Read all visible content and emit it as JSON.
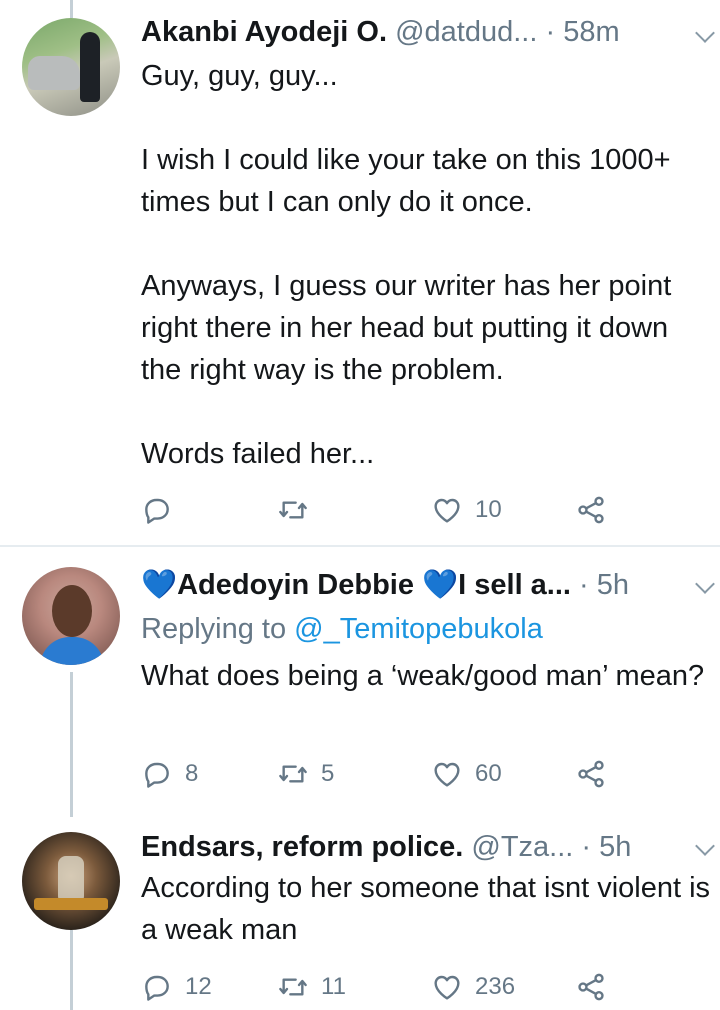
{
  "tweets": [
    {
      "name": "Akanbi Ayodeji O.",
      "handle": "@datdud...",
      "separator": "·",
      "time": "58m",
      "text": "Guy, guy, guy...\n\nI wish I could like your take on this 1000+ times but I can only do it once.\n\nAnyways, I guess our writer has her point right there in her head but putting it down the right way is the problem.\n\nWords failed her...",
      "reply_count": "",
      "retweet_count": "",
      "like_count": "10"
    },
    {
      "name_prefix_emoji": "💙",
      "name": "Adedoyin Debbie",
      "name_mid_emoji": "💙",
      "name_suffix": "I sell a...",
      "separator": "·",
      "time": "5h",
      "replying_label": "Replying to",
      "replying_mention": "@_Temitopebukola",
      "text": "What does being a ‘weak/good man’ mean?",
      "reply_count": "8",
      "retweet_count": "5",
      "like_count": "60"
    },
    {
      "name": "Endsars, reform police.",
      "handle": "@Tza...",
      "separator": "·",
      "time": "5h",
      "text": "According to her someone that isnt violent is a weak man",
      "reply_count": "12",
      "retweet_count": "11",
      "like_count": "236"
    }
  ],
  "icons": {
    "reply": "reply-icon",
    "retweet": "retweet-icon",
    "like": "heart-icon",
    "share": "share-icon",
    "more": "chevron-down-icon"
  },
  "colors": {
    "text": "#14171a",
    "secondary": "#657786",
    "link": "#1b95e0",
    "thread_line": "#c4cfd6",
    "divider": "#e6ecf0"
  }
}
